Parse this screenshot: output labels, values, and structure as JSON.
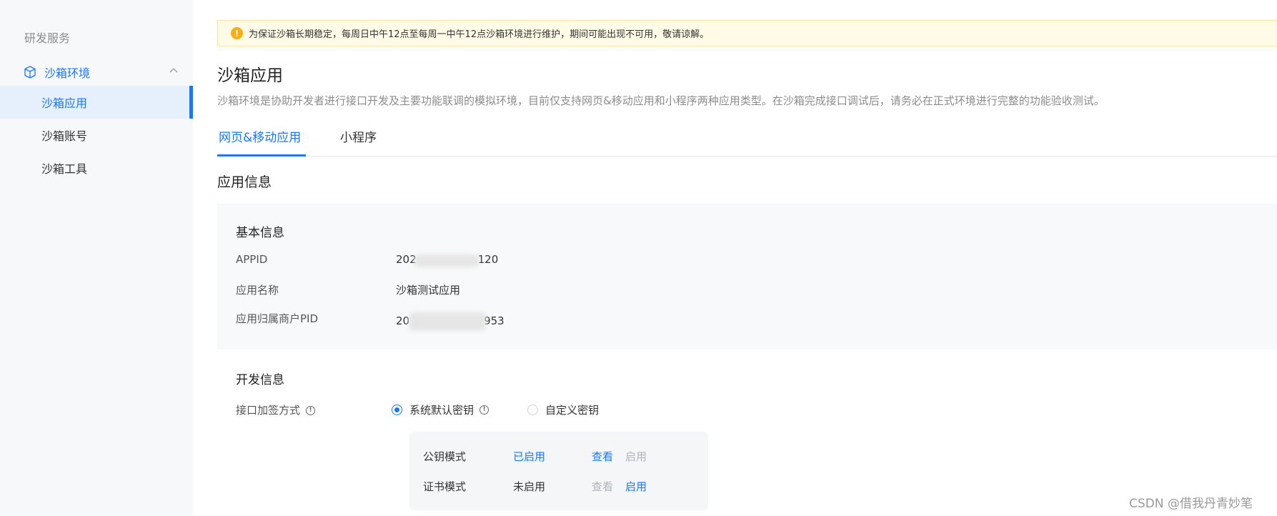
{
  "sidebar": {
    "group_label": "研发服务",
    "parent": {
      "label": "沙箱环境"
    },
    "items": [
      {
        "label": "沙箱应用"
      },
      {
        "label": "沙箱账号"
      },
      {
        "label": "沙箱工具"
      }
    ]
  },
  "notice": {
    "text": "为保证沙箱长期稳定，每周日中午12点至每周一中午12点沙箱环境进行维护，期间可能出现不可用，敬请谅解。"
  },
  "page": {
    "title": "沙箱应用",
    "description": "沙箱环境是协助开发者进行接口开发及主要功能联调的模拟环境，目前仅支持网页&移动应用和小程序两种应用类型。在沙箱完成接口调试后，请务必在正式环境进行完整的功能验收测试。"
  },
  "tabs": [
    {
      "label": "网页&移动应用"
    },
    {
      "label": "小程序"
    }
  ],
  "section_title": "应用信息",
  "basic_info": {
    "title": "基本信息",
    "rows": [
      {
        "label": "APPID",
        "value_start": "202",
        "value_end": "120"
      },
      {
        "label": "应用名称",
        "value": "沙箱测试应用"
      },
      {
        "label": "应用归属商户PID",
        "value_start": "20",
        "value_end": "953"
      }
    ]
  },
  "dev_info": {
    "title": "开发信息",
    "sign_label": "接口加签方式",
    "options": [
      {
        "label": "系统默认密钥"
      },
      {
        "label": "自定义密钥"
      }
    ],
    "modes": [
      {
        "name": "公钥模式",
        "status": "已启用",
        "view": "查看",
        "enable": "启用"
      },
      {
        "name": "证书模式",
        "status": "未启用",
        "view": "查看",
        "enable": "启用"
      }
    ]
  },
  "watermark": "CSDN @借我丹青妙笔",
  "colors": {
    "accent": "#1677ff",
    "notice_bg": "#fffbe6",
    "warning": "#faad14"
  }
}
